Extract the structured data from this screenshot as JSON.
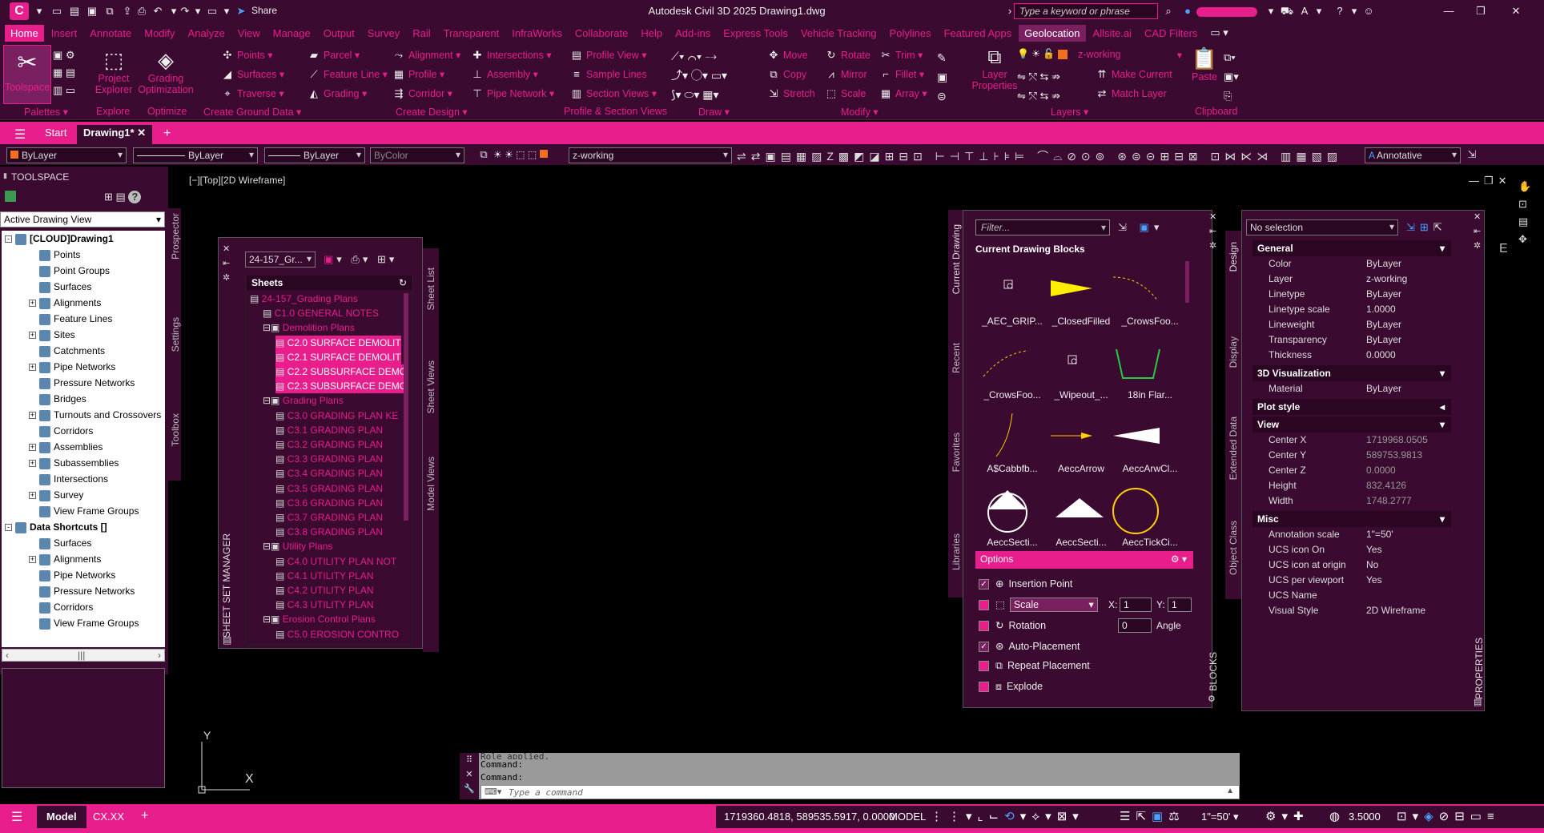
{
  "app": {
    "title": "Autodesk Civil 3D 2025   Drawing1.dwg",
    "icon_letter": "C",
    "share_label": "Share",
    "search_placeholder": "Type a keyword or phrase"
  },
  "ribbon_tabs": [
    "Home",
    "Insert",
    "Annotate",
    "Modify",
    "Analyze",
    "View",
    "Manage",
    "Output",
    "Survey",
    "Rail",
    "Transparent",
    "InfraWorks",
    "Collaborate",
    "Help",
    "Add-ins",
    "Express Tools",
    "Vehicle Tracking",
    "Polylines",
    "Featured Apps",
    "Geolocation",
    "Allsite.ai",
    "CAD Filters"
  ],
  "ribbon": {
    "palettes": {
      "toolspace": "Toolspace"
    },
    "explore": {
      "project_explorer": "Project Explorer"
    },
    "optimize": {
      "grading_optimization": "Grading Optimization"
    },
    "ground": [
      "Points",
      "Surfaces",
      "Traverse"
    ],
    "design_col1": [
      "Parcel",
      "Feature Line",
      "Grading"
    ],
    "design_col2": [
      "Alignment",
      "Profile",
      "Corridor"
    ],
    "design_col3": [
      "Intersections",
      "Assembly",
      "Pipe Network"
    ],
    "profile_section": [
      "Profile View",
      "Sample Lines",
      "Section Views"
    ],
    "modify_col1": [
      "Move",
      "Copy",
      "Stretch"
    ],
    "modify_col2": [
      "Rotate",
      "Mirror",
      "Scale"
    ],
    "modify_col3": [
      "Trim",
      "Fillet",
      "Array"
    ],
    "layers": {
      "current": "z-working",
      "make_current": "Make Current",
      "match_layer": "Match Layer",
      "layer_properties": "Layer Properties"
    },
    "clipboard": {
      "paste": "Paste"
    },
    "panel_labels": [
      "Palettes",
      "Explore",
      "Optimize",
      "Create Ground Data",
      "Create Design",
      "Profile & Section Views",
      "Draw",
      "Modify",
      "Layers",
      "Clipboard"
    ]
  },
  "file_tabs": {
    "start": "Start",
    "drawing": "Drawing1*"
  },
  "prop_toolbar": {
    "color": "ByLayer",
    "linetype": "ByLayer",
    "lineweight": "ByLayer",
    "plotstyle": "ByColor",
    "layer": "z-working",
    "annotative": "Annotative"
  },
  "toolspace": {
    "header": "TOOLSPACE",
    "view_combo": "Active Drawing View",
    "side_tabs": [
      "Prospector",
      "Settings",
      "Toolbox"
    ],
    "tree": [
      {
        "label": "[CLOUD]Drawing1",
        "level": 0,
        "exp": "-"
      },
      {
        "label": "Points",
        "level": 1,
        "exp": ""
      },
      {
        "label": "Point Groups",
        "level": 1,
        "exp": ""
      },
      {
        "label": "Surfaces",
        "level": 1,
        "exp": ""
      },
      {
        "label": "Alignments",
        "level": 1,
        "exp": "+"
      },
      {
        "label": "Feature Lines",
        "level": 1,
        "exp": ""
      },
      {
        "label": "Sites",
        "level": 1,
        "exp": "+"
      },
      {
        "label": "Catchments",
        "level": 1,
        "exp": ""
      },
      {
        "label": "Pipe Networks",
        "level": 1,
        "exp": "+"
      },
      {
        "label": "Pressure Networks",
        "level": 1,
        "exp": ""
      },
      {
        "label": "Bridges",
        "level": 1,
        "exp": ""
      },
      {
        "label": "Turnouts and Crossovers",
        "level": 1,
        "exp": "+"
      },
      {
        "label": "Corridors",
        "level": 1,
        "exp": ""
      },
      {
        "label": "Assemblies",
        "level": 1,
        "exp": "+"
      },
      {
        "label": "Subassemblies",
        "level": 1,
        "exp": "+"
      },
      {
        "label": "Intersections",
        "level": 1,
        "exp": ""
      },
      {
        "label": "Survey",
        "level": 1,
        "exp": "+"
      },
      {
        "label": "View Frame Groups",
        "level": 1,
        "exp": ""
      },
      {
        "label": "Data Shortcuts []",
        "level": 0,
        "exp": "-"
      },
      {
        "label": "Surfaces",
        "level": 1,
        "exp": ""
      },
      {
        "label": "Alignments",
        "level": 1,
        "exp": "+"
      },
      {
        "label": "Pipe Networks",
        "level": 1,
        "exp": ""
      },
      {
        "label": "Pressure Networks",
        "level": 1,
        "exp": ""
      },
      {
        "label": "Corridors",
        "level": 1,
        "exp": ""
      },
      {
        "label": "View Frame Groups",
        "level": 1,
        "exp": ""
      }
    ]
  },
  "viewport": {
    "label": "[−][Top][2D Wireframe]",
    "ucs_y": "Y",
    "ucs_x": "X"
  },
  "sheet_set": {
    "combo": "24-157_Gr...",
    "header": "Sheets",
    "side_label": "SHEET SET MANAGER",
    "tabs": [
      "Sheet List",
      "Sheet Views",
      "Model Views"
    ],
    "nodes": [
      {
        "label": "24-157_Grading Plans",
        "level": 0,
        "hl": false
      },
      {
        "label": "C1.0 GENERAL NOTES",
        "level": 1,
        "hl": false
      },
      {
        "label": "Demolition Plans",
        "level": 1,
        "hl": false
      },
      {
        "label": "C2.0 SURFACE DEMOLIT",
        "level": 2,
        "hl": true
      },
      {
        "label": "C2.1 SURFACE DEMOLIT",
        "level": 2,
        "hl": true
      },
      {
        "label": "C2.2 SUBSURFACE DEMO",
        "level": 2,
        "hl": true
      },
      {
        "label": "C2.3 SUBSURFACE DEMO",
        "level": 2,
        "hl": true
      },
      {
        "label": "Grading Plans",
        "level": 1,
        "hl": false
      },
      {
        "label": "C3.0 GRADING PLAN KE",
        "level": 2,
        "hl": false
      },
      {
        "label": "C3.1 GRADING PLAN",
        "level": 2,
        "hl": false
      },
      {
        "label": "C3.2 GRADING PLAN",
        "level": 2,
        "hl": false
      },
      {
        "label": "C3.3 GRADING PLAN",
        "level": 2,
        "hl": false
      },
      {
        "label": "C3.4 GRADING PLAN",
        "level": 2,
        "hl": false
      },
      {
        "label": "C3.5 GRADING PLAN",
        "level": 2,
        "hl": false
      },
      {
        "label": "C3.6 GRADING PLAN",
        "level": 2,
        "hl": false
      },
      {
        "label": "C3.7 GRADING PLAN",
        "level": 2,
        "hl": false
      },
      {
        "label": "C3.8 GRADING PLAN",
        "level": 2,
        "hl": false
      },
      {
        "label": "Utility Plans",
        "level": 1,
        "hl": false
      },
      {
        "label": "C4.0 UTILITY PLAN NOT",
        "level": 2,
        "hl": false
      },
      {
        "label": "C4.1 UTILITY PLAN",
        "level": 2,
        "hl": false
      },
      {
        "label": "C4.2 UTILITY PLAN",
        "level": 2,
        "hl": false
      },
      {
        "label": "C4.3 UTILITY PLAN",
        "level": 2,
        "hl": false
      },
      {
        "label": "Erosion Control Plans",
        "level": 1,
        "hl": false
      },
      {
        "label": "C5.0 EROSION CONTRO",
        "level": 2,
        "hl": false
      }
    ]
  },
  "blocks": {
    "filter_placeholder": "Filter...",
    "header": "Current Drawing Blocks",
    "side_tabs": [
      "Current Drawing",
      "Recent",
      "Favorites",
      "Libraries"
    ],
    "side_label": "BLOCKS",
    "items": [
      "_AEC_GRIP...",
      "_ClosedFilled",
      "_CrowsFoo...",
      "_CrowsFoo...",
      "_Wipeout_...",
      "18in Flar...",
      "A$Cabbfb...",
      "AeccArrow",
      "AeccArwCl...",
      "AeccSecti...",
      "AeccSecti...",
      "AeccTickCi..."
    ],
    "options_label": "Options",
    "options": {
      "insertion_point": "Insertion Point",
      "scale": "Scale",
      "x_label": "X:",
      "x_value": "1",
      "y_label": "Y:",
      "y_value": "1",
      "rotation": "Rotation",
      "angle_value": "0",
      "angle_label": "Angle",
      "auto_placement": "Auto-Placement",
      "repeat_placement": "Repeat Placement",
      "explode": "Explode"
    }
  },
  "properties": {
    "selection": "No selection",
    "side_tabs": [
      "Design",
      "Display",
      "Extended Data",
      "Object Class"
    ],
    "side_label": "PROPERTIES",
    "sections": {
      "general": "General",
      "viz": "3D Visualization",
      "plot": "Plot style",
      "view": "View",
      "misc": "Misc"
    },
    "general": [
      {
        "k": "Color",
        "v": "ByLayer"
      },
      {
        "k": "Layer",
        "v": "z-working"
      },
      {
        "k": "Linetype",
        "v": "ByLayer"
      },
      {
        "k": "Linetype scale",
        "v": "1.0000"
      },
      {
        "k": "Lineweight",
        "v": "ByLayer"
      },
      {
        "k": "Transparency",
        "v": "ByLayer"
      },
      {
        "k": "Thickness",
        "v": "0.0000"
      }
    ],
    "viz": [
      {
        "k": "Material",
        "v": "ByLayer"
      }
    ],
    "view": [
      {
        "k": "Center X",
        "v": "1719968.0505"
      },
      {
        "k": "Center Y",
        "v": "589753.9813"
      },
      {
        "k": "Center Z",
        "v": "0.0000"
      },
      {
        "k": "Height",
        "v": "832.4126"
      },
      {
        "k": "Width",
        "v": "1748.2777"
      }
    ],
    "misc": [
      {
        "k": "Annotation scale",
        "v": "1\"=50'"
      },
      {
        "k": "UCS icon On",
        "v": "Yes"
      },
      {
        "k": "UCS icon at origin",
        "v": "No"
      },
      {
        "k": "UCS per viewport",
        "v": "Yes"
      },
      {
        "k": "UCS Name",
        "v": ""
      },
      {
        "k": "Visual Style",
        "v": "2D Wireframe"
      }
    ]
  },
  "command": {
    "line1": "Role applied.",
    "line2": "Command:",
    "line3": "Command:",
    "placeholder": "Type a command"
  },
  "statusbar": {
    "model_tab": "Model",
    "layout_tab": "CX.XX",
    "coords": "1719360.4818, 589535.5917, 0.0000",
    "model_label": "MODEL",
    "scale": "1\"=50'",
    "annotation_value": "3.5000"
  },
  "colors": {
    "accent": "#e81e8c",
    "panel": "#3a0a30",
    "dark": "#2a0622"
  }
}
